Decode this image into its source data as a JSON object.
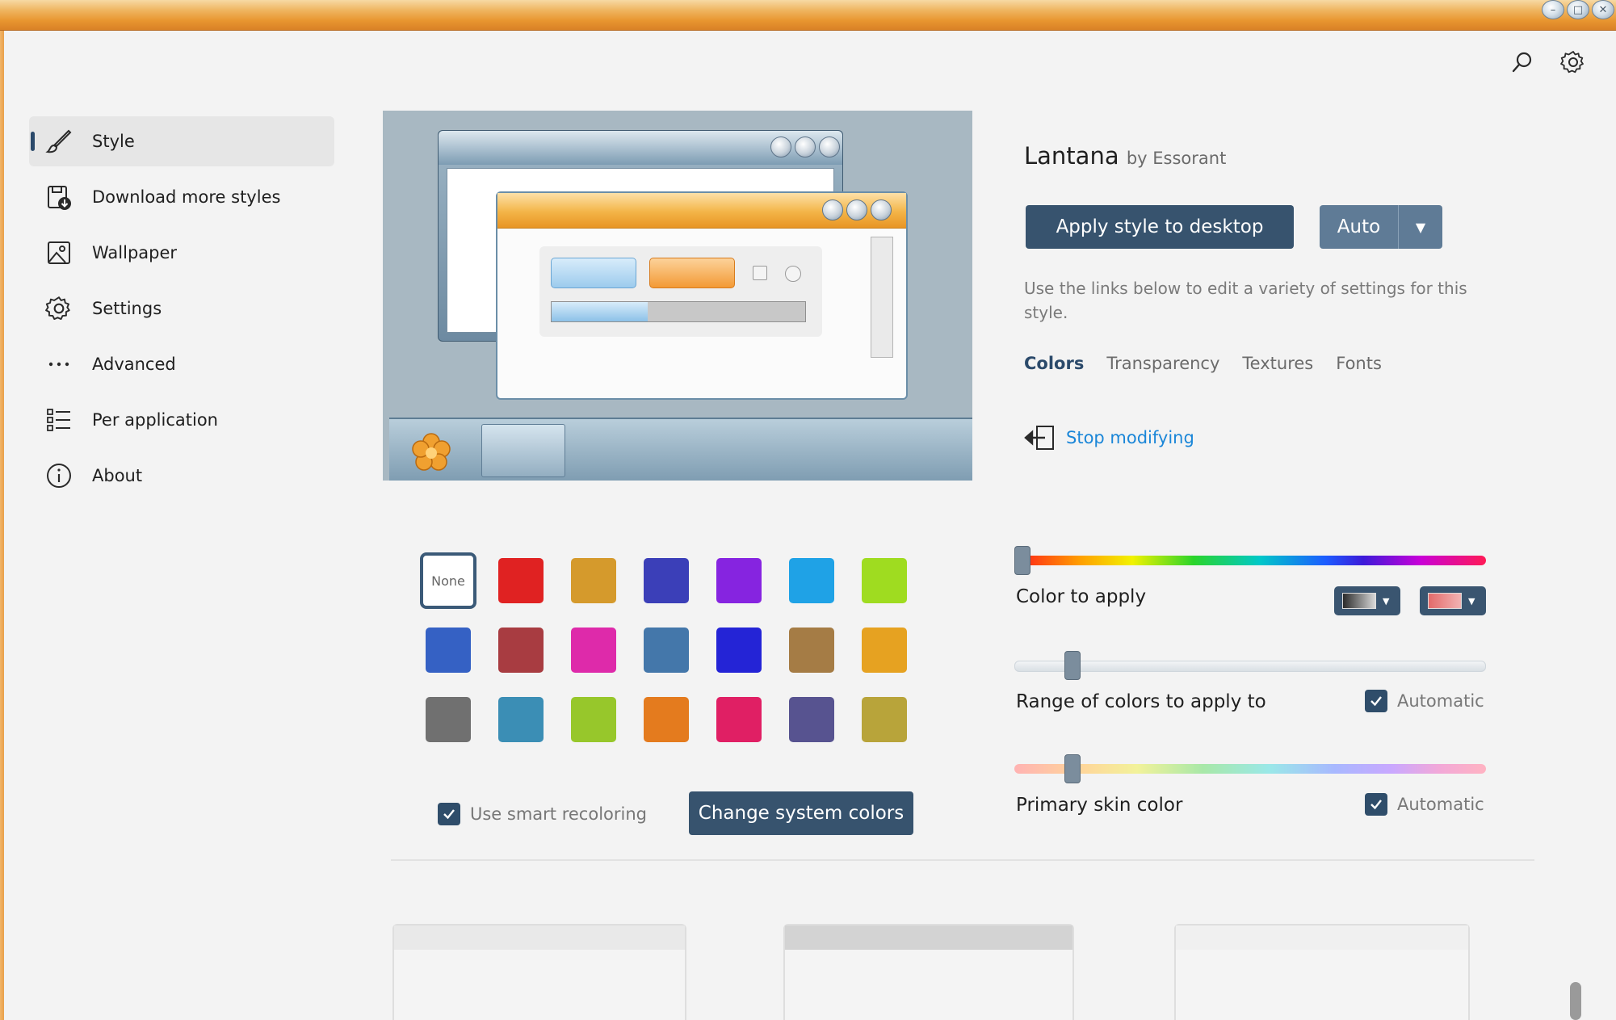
{
  "window": {
    "controls": [
      "minimize",
      "maximize",
      "close"
    ]
  },
  "toolbar": {
    "icons": [
      "search-icon",
      "gear-icon"
    ]
  },
  "sidebar": {
    "items": [
      {
        "label": "Style",
        "icon": "brush-icon",
        "active": true
      },
      {
        "label": "Download more styles",
        "icon": "download-styles-icon",
        "active": false
      },
      {
        "label": "Wallpaper",
        "icon": "picture-icon",
        "active": false
      },
      {
        "label": "Settings",
        "icon": "gear-icon",
        "active": false
      },
      {
        "label": "Advanced",
        "icon": "more-dots-icon",
        "active": false
      },
      {
        "label": "Per application",
        "icon": "list-icon",
        "active": false
      },
      {
        "label": "About",
        "icon": "info-icon",
        "active": false
      }
    ]
  },
  "style": {
    "name": "Lantana",
    "author": "by Essorant",
    "apply_label": "Apply style to desktop",
    "auto_label": "Auto",
    "description": "Use the links below to edit a variety of settings for this style.",
    "tabs": [
      {
        "label": "Colors",
        "active": true
      },
      {
        "label": "Transparency",
        "active": false
      },
      {
        "label": "Textures",
        "active": false
      },
      {
        "label": "Fonts",
        "active": false
      }
    ],
    "stop_modifying": "Stop modifying"
  },
  "colors": {
    "none_label": "None",
    "swatches": [
      "none",
      "#e02222",
      "#d59a2c",
      "#3b3fb8",
      "#8624e0",
      "#1fa2e6",
      "#9fdc20",
      "#3561c4",
      "#a83c41",
      "#de2aaa",
      "#4477aa",
      "#2424d6",
      "#a57c45",
      "#e6a221",
      "#707070",
      "#3b8eb5",
      "#97c72b",
      "#e47b1e",
      "#e01f64",
      "#575390",
      "#b8a43a"
    ],
    "smart_recoloring_label": "Use smart recoloring",
    "change_system_colors_label": "Change system colors",
    "color_to_apply_label": "Color to apply",
    "range_label": "Range of colors to apply to",
    "range_automatic_label": "Automatic",
    "skin_label": "Primary skin color",
    "skin_automatic_label": "Automatic",
    "hue_value": 0.0,
    "range_value": 0.11,
    "skin_value": 0.11,
    "picker1_color": "#2b2b2b",
    "picker2_color": "#e36a6a"
  },
  "accent": "#37536e"
}
